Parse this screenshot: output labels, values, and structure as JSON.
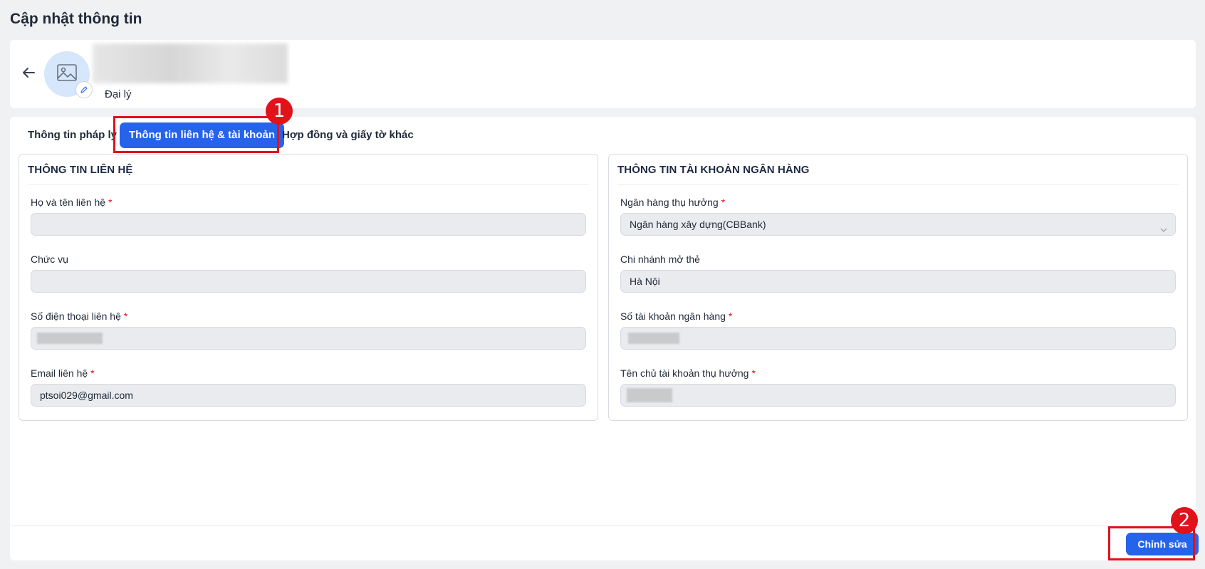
{
  "page": {
    "title": "Cập nhật thông tin"
  },
  "profile": {
    "role": "Đại lý"
  },
  "tabs": [
    {
      "label": "Thông tin pháp lý",
      "active": false
    },
    {
      "label": "Thông tin liên hệ & tài khoản",
      "active": true
    },
    {
      "label": "Hợp đồng và giấy tờ khác",
      "active": false
    }
  ],
  "annotations": [
    "1",
    "2"
  ],
  "contact": {
    "title": "THÔNG TIN LIÊN HỆ",
    "fields": [
      {
        "label": "Họ và tên liên hệ",
        "required": "*",
        "value": ""
      },
      {
        "label": "Chức vụ",
        "value": ""
      },
      {
        "label": "Số điện thoại liên hệ",
        "required": "*",
        "value": ""
      },
      {
        "label": "Email liên hệ",
        "required": "*",
        "value": "ptsoi029@gmail.com"
      }
    ]
  },
  "bank": {
    "title": "THÔNG TIN TÀI KHOẢN NGÂN HÀNG",
    "fields": [
      {
        "label": "Ngân hàng thụ hưởng",
        "required": "*",
        "value": "Ngân hàng xây dựng(CBBank)"
      },
      {
        "label": "Chi nhánh mở thẻ",
        "value": "Hà Nội"
      },
      {
        "label": "Số tài khoản ngân hàng",
        "required": "*",
        "value": ""
      },
      {
        "label": "Tên chủ tài khoản thụ hưởng",
        "required": "*",
        "value": ""
      }
    ]
  },
  "footer": {
    "edit_label": "Chỉnh sửa"
  },
  "colors": {
    "primary": "#2563eb",
    "annotation": "#e0121a",
    "required": "#e0121a"
  },
  "icons": {
    "back": "arrow-left-icon",
    "avatar": "image-placeholder-icon",
    "avatar_edit": "pencil-icon",
    "select": "chevron-down-icon"
  }
}
